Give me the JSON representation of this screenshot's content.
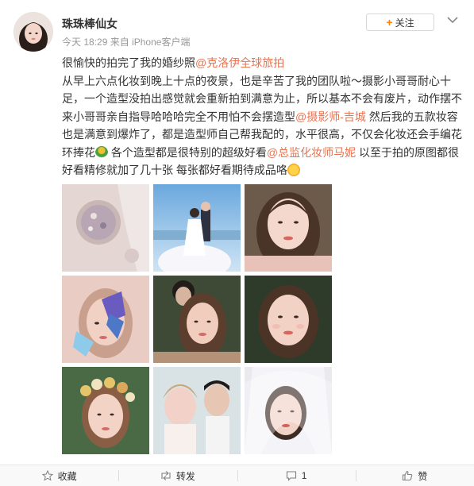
{
  "post": {
    "nickname": "珠珠棒仙女",
    "time": "今天 18:29",
    "source_prefix": "来自",
    "source": "iPhone客户端",
    "follow_label": "关注",
    "text": {
      "line1": "很愉快的拍完了我的婚纱照",
      "mention_1": "@克洛伊全球旅拍",
      "para_1": "从早上六点化妆到晚上十点的夜景，也是辛苦了我的团队啦～摄影小哥哥耐心十足，一个造型没拍出感觉就会重新拍到满意为止，所以基本不会有废片，动作摆不来小哥哥亲自指导哈哈哈完全不用怕不会摆造型",
      "mention_2": "@摄影师-吉城",
      "para_2": " 然后我的五款妆容也是满意到爆炸了，都是造型师自己帮我配的，水平很高，不仅会化妆还会手编花环捧花",
      "para_3": " 各个造型都是很特别的超级好看",
      "mention_3": "@总监化妆师马妮",
      "para_4": " 以至于拍的原图都很好看精修就加了几十张 每张都好看期待成品咯"
    }
  },
  "actions": {
    "favorite": "收藏",
    "repost": "转发",
    "comment_count": "1",
    "like": "赞"
  },
  "colors": {
    "link": "#eb7350",
    "follow_plus": "#ff8200"
  }
}
